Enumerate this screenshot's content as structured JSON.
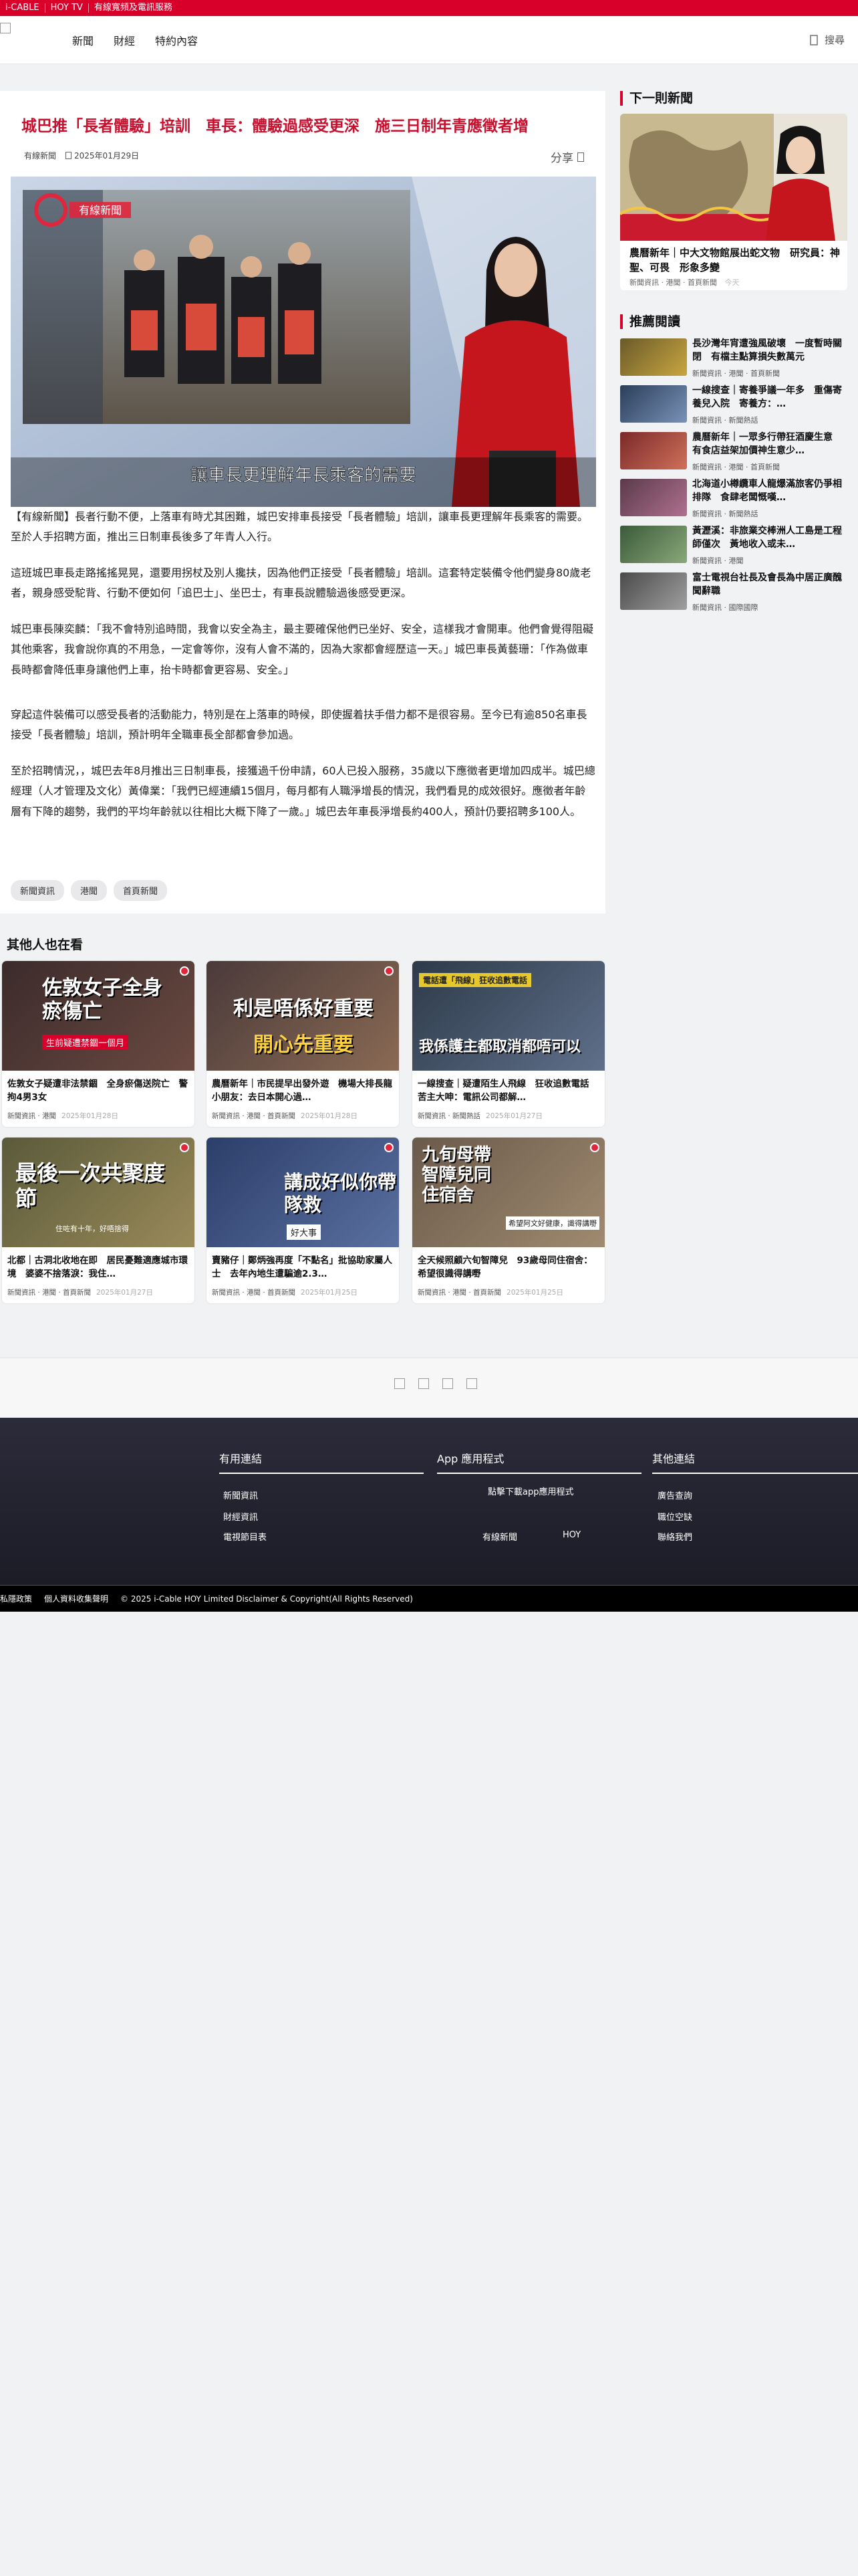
{
  "topbar": [
    "i-CABLE",
    "HOY TV",
    "有線寬頻及電訊服務"
  ],
  "nav": {
    "links": [
      "新聞",
      "財經",
      "特約內容"
    ],
    "search_label": "搜尋"
  },
  "article": {
    "title": "城巴推「長者體驗」培訓　車長：體驗過感受更深　施三日制年青應徵者增",
    "source": "有線新聞",
    "date": "2025年01月29日",
    "share_label": "分享",
    "video_logo": "有線新聞",
    "video_caption": "讓車長更理解年長乘客的需要",
    "paragraphs": [
      "【有線新聞】長者行動不便，上落車有時尤其困難，城巴安排車長接受「長者體驗」培訓，讓車長更理解年長乘客的需要。至於人手招聘方面，推出三日制車長後多了年青人入行。",
      "這班城巴車長走路搖搖晃晃，還要用拐杖及別人攙扶，因為他們正接受「長者體驗」培訓。這套特定裝備令他們變身80歲老者，親身感受駝背、行動不便如何「追巴士」、坐巴士，有車長說體驗過後感受更深。",
      "城巴車長陳奕麟：「我不會特別追時間，我會以安全為主，最主要確保他們已坐好、安全，這樣我才會開車。他們會覺得阻礙其他乘客，我會說你真的不用急，一定會等你，沒有人會不滿的，因為大家都會經歷這一天。」城巴車長黃藝珊：「作為做車長時都會降低車身讓他們上車，抬卡時都會更容易、安全。」",
      "穿起這件裝備可以感受長者的活動能力，特別是在上落車的時候，即使握着扶手借力都不是很容易。至今已有逾850名車長接受「長者體驗」培訓，預計明年全職車長全部都會參加過。",
      "至於招聘情況，，城巴去年8月推出三日制車長，接獲過千份申請，60人已投入服務，35歲以下應徵者更增加四成半。城巴總經理（人才管理及文化）黃偉業：「我們已經連續15個月，每月都有人職淨增長的情況，我們看見的成效很好。應徵者年齡層有下降的趨勢，我們的平均年齡就以往相比大概下降了一歲。」城巴去年車長淨增長約400人，預計仍要招聘多100人。"
    ],
    "tags": [
      "新聞資訊",
      "港聞",
      "首頁新聞"
    ]
  },
  "sidebar": {
    "next_heading": "下一則新聞",
    "next": {
      "title": "農曆新年｜中大文物館展出蛇文物　研究員：神聖、可畏　形象多變",
      "tags": "新聞資訊 · 港聞 · 首頁新聞",
      "date": "今天"
    },
    "rec_heading": "推薦閱讀",
    "recommended": [
      {
        "title": "長沙灣年宵遭強風破壞　一度暫時關閉　有檔主點算損失數萬元",
        "tags": "新聞資訊 · 港聞 · 首頁新聞"
      },
      {
        "title": "一線搜查｜寄養爭議一年多　重傷寄養兒入院　寄養方：…",
        "tags": "新聞資訊 · 新聞熱話"
      },
      {
        "title": "農曆新年｜一眾多行帶狂酒慶生意　有食店益架加價神生意少…",
        "tags": "新聞資訊 · 港聞 · 首頁新聞"
      },
      {
        "title": "北海道小樽纜車人龍爆滿旅客仍爭相排隊　食肆老闆慨嘆…",
        "tags": "新聞資訊 · 新聞熱話"
      },
      {
        "title": "黃瀝溪：非旅業交棒洲人工島是工程師僅次　黃地收入或未…",
        "tags": "新聞資訊 · 港聞"
      },
      {
        "title": "富士電視台社長及會長為中居正廣醜聞辭職",
        "tags": "新聞資訊 · 國際國際"
      }
    ]
  },
  "others": {
    "heading": "其他人也在看",
    "cards": [
      {
        "title": "佐敦女子疑遭非法禁錮　全身瘀傷送院亡　警拘4男3女",
        "tags": "新聞資訊 · 港聞",
        "date": "2025年01月28日",
        "img_text": "佐敦女子全身瘀傷亡",
        "img_sub": "生前疑遭禁錮一個月",
        "colors": [
          "#3b2b2b",
          "#6b4a42"
        ]
      },
      {
        "title": "農曆新年｜市民提早出發外遊　機場大排長龍　小朋友：去日本開心過…",
        "tags": "新聞資訊 · 港聞 · 首頁新聞",
        "date": "2025年01月28日",
        "img_text": "利是唔係好重要",
        "img_sub": "開心先重要",
        "colors": [
          "#4a3a3a",
          "#8a6a54"
        ]
      },
      {
        "title": "一線搜查｜疑遭陌生人飛線　狂收追數電話　苦主大呻：電訊公司都解…",
        "tags": "新聞資訊 · 新聞熱話",
        "date": "2025年01月27日",
        "img_text": "我係護主都取消都唔可以",
        "img_sub": "電話遭「飛線」狂收追數電話",
        "colors": [
          "#2d3a4a",
          "#60708a"
        ]
      },
      {
        "title": "北都｜古洞北收地在即　居民憂難適應城市環境　婆婆不捨落淚：我住…",
        "tags": "新聞資訊 · 港聞 · 首頁新聞",
        "date": "2025年01月27日",
        "img_text": "最後一次共聚度節",
        "img_sub": "住咗有十年，好唔捨得",
        "colors": [
          "#5a5a3a",
          "#9a8a5a"
        ]
      },
      {
        "title": "賣豬仔｜鄭炳強再度「不點名」批協助家屬人士　去年內地生遭騙逾2.3…",
        "tags": "新聞資訊 · 港聞 · 首頁新聞",
        "date": "2025年01月25日",
        "img_text": "講成好似你帶隊救",
        "img_sub": "好大事",
        "colors": [
          "#2c3e6a",
          "#5a70a0"
        ]
      },
      {
        "title": "全天候照顧六旬智障兒　93歲母同住宿舍：希望很識得講嘢",
        "tags": "新聞資訊 · 港聞 · 首頁新聞",
        "date": "2025年01月25日",
        "img_text": "九旬母帶智障兒同住宿舍",
        "img_sub": "希望阿文好健康，識得講嘢",
        "colors": [
          "#6a5a4a",
          "#a08a70"
        ]
      }
    ]
  },
  "footer": {
    "col1_title": "有用連結",
    "col1_links": [
      "新聞資訊",
      "財經資訊",
      "電視節目表"
    ],
    "col2_title": "App 應用程式",
    "col2_text": "點擊下載app應用程式",
    "col2_apps": [
      "有線新聞",
      "HOY"
    ],
    "col3_title": "其他連結",
    "col3_links": [
      "廣告查詢",
      "職位空缺",
      "聯絡我們"
    ],
    "copyright": [
      "私隱政策",
      "個人資料收集聲明",
      "© 2025 i-Cable HOY Limited Disclaimer & Copyright(All Rights Reserved)"
    ]
  }
}
